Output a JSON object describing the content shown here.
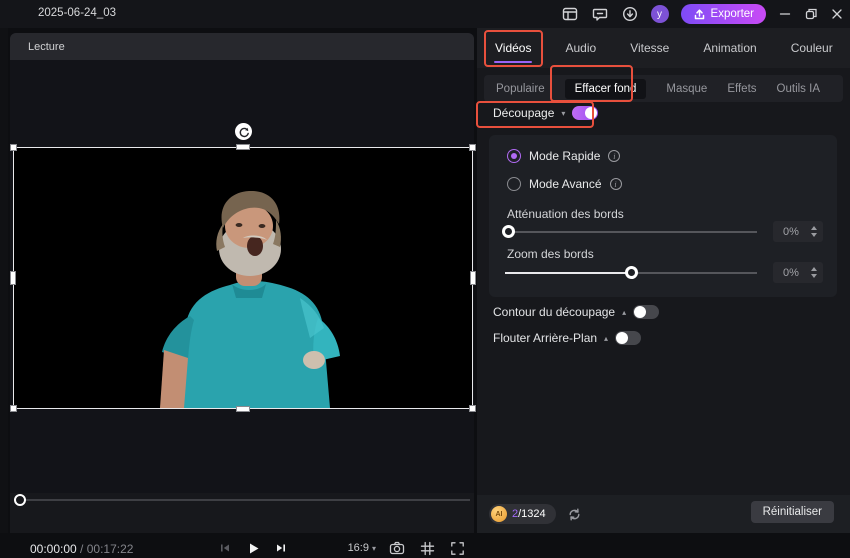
{
  "colors": {
    "accent_purple": "#9b63f8",
    "toggle_purple": "#b06af2",
    "highlight_red": "#e8503d",
    "export_gradient_start": "#7e4bf5",
    "export_gradient_end": "#c94bf5",
    "shirt_teal": "#2aa3ad",
    "panel_bg": "#17181c"
  },
  "icons": {
    "caret_down": "▾",
    "caret_up": "▴",
    "info_letter": "i",
    "ai_badge": "AI"
  },
  "titlebar": {
    "title": "2025-06-24_03",
    "avatar_letter": "y",
    "export_label": "Exporter"
  },
  "preview": {
    "header_tab": "Lecture",
    "time_current": "00:00:00",
    "time_separator": " / ",
    "time_total": "00:17:22",
    "aspect_ratio": "16:9"
  },
  "right_panel": {
    "tabs": [
      {
        "label": "Vidéos",
        "selected": true
      },
      {
        "label": "Audio",
        "selected": false
      },
      {
        "label": "Vitesse",
        "selected": false
      },
      {
        "label": "Animation",
        "selected": false
      },
      {
        "label": "Couleur",
        "selected": false
      }
    ],
    "subtabs": [
      {
        "label": "Populaire",
        "selected": false
      },
      {
        "label": "Effacer fond",
        "selected": true
      },
      {
        "label": "Masque",
        "selected": false
      },
      {
        "label": "Effets",
        "selected": false
      },
      {
        "label": "Outils IA",
        "selected": false
      }
    ],
    "decoupage": {
      "label": "Découpage",
      "enabled": true
    },
    "modes": [
      {
        "label": "Mode Rapide",
        "selected": true
      },
      {
        "label": "Mode Avancé",
        "selected": false
      }
    ],
    "sliders": [
      {
        "label": "Atténuation des bords",
        "value": "0%",
        "position_pct": 0
      },
      {
        "label": "Zoom des bords",
        "value": "0%",
        "position_pct": 50
      }
    ],
    "toggles": [
      {
        "label": "Contour du découpage",
        "on": false
      },
      {
        "label": "Flouter Arrière-Plan",
        "on": false
      }
    ],
    "footer": {
      "counter_current": "2",
      "counter_total": "/1324",
      "reset_label": "Réinitialiser"
    }
  }
}
